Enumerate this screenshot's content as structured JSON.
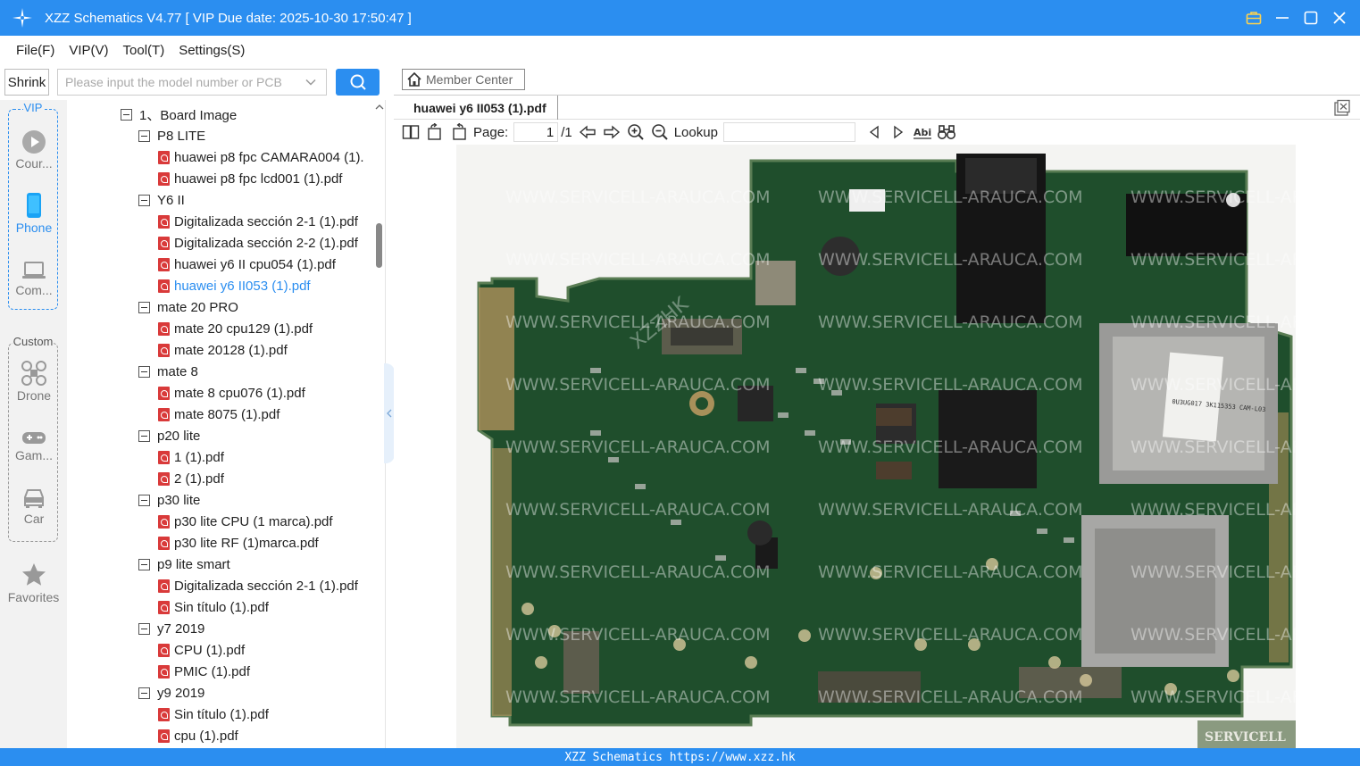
{
  "window": {
    "title": "XZZ Schematics V4.77 [ VIP Due date: 2025-10-30 17:50:47 ]",
    "accent_color": "#2b8ef0",
    "controls": [
      "briefcase-icon",
      "minimize-icon",
      "maximize-icon",
      "close-icon"
    ]
  },
  "menu": {
    "file": "File(F)",
    "vip": "VIP(V)",
    "tool": "Tool(T)",
    "settings": "Settings(S)"
  },
  "left_toolbar": {
    "shrink_label": "Shrink",
    "search_placeholder": "Please input the model number or PCB"
  },
  "categories": {
    "vip_label": "VIP",
    "custom_label": "Custom",
    "items": [
      {
        "label": "Cour...",
        "icon": "play-icon"
      },
      {
        "label": "Phone",
        "icon": "phone-icon"
      },
      {
        "label": "Com...",
        "icon": "laptop-icon"
      },
      {
        "label": "Drone",
        "icon": "drone-icon"
      },
      {
        "label": "Gam...",
        "icon": "gamepad-icon"
      },
      {
        "label": "Car",
        "icon": "car-icon"
      }
    ],
    "favorites_label": "Favorites"
  },
  "tree": {
    "root": "1、Board Image",
    "nodes": [
      {
        "type": "folder",
        "label": "P8 LITE"
      },
      {
        "type": "file",
        "label": "huawei p8 fpc CAMARA004 (1)."
      },
      {
        "type": "file",
        "label": "huawei p8 fpc lcd001 (1).pdf"
      },
      {
        "type": "folder",
        "label": "Y6 II"
      },
      {
        "type": "file",
        "label": "Digitalizada sección 2-1 (1).pdf"
      },
      {
        "type": "file",
        "label": "Digitalizada sección 2-2 (1).pdf"
      },
      {
        "type": "file",
        "label": "huawei y6 II cpu054 (1).pdf"
      },
      {
        "type": "file",
        "label": "huawei y6 II053 (1).pdf",
        "selected": true
      },
      {
        "type": "folder",
        "label": "mate 20 PRO"
      },
      {
        "type": "file",
        "label": "mate 20 cpu129 (1).pdf"
      },
      {
        "type": "file",
        "label": "mate 20128 (1).pdf"
      },
      {
        "type": "folder",
        "label": "mate 8"
      },
      {
        "type": "file",
        "label": "mate 8 cpu076 (1).pdf"
      },
      {
        "type": "file",
        "label": "mate 8075 (1).pdf"
      },
      {
        "type": "folder",
        "label": "p20 lite"
      },
      {
        "type": "file",
        "label": "1 (1).pdf"
      },
      {
        "type": "file",
        "label": "2 (1).pdf"
      },
      {
        "type": "folder",
        "label": "p30 lite"
      },
      {
        "type": "file",
        "label": "p30 lite CPU (1 marca).pdf"
      },
      {
        "type": "file",
        "label": "p30 lite RF (1)marca.pdf"
      },
      {
        "type": "folder",
        "label": "p9 lite smart"
      },
      {
        "type": "file",
        "label": "Digitalizada sección 2-1 (1).pdf"
      },
      {
        "type": "file",
        "label": "Sin título (1).pdf"
      },
      {
        "type": "folder",
        "label": "y7 2019"
      },
      {
        "type": "file",
        "label": "CPU (1).pdf"
      },
      {
        "type": "file",
        "label": "PMIC (1).pdf"
      },
      {
        "type": "folder",
        "label": "y9 2019"
      },
      {
        "type": "file",
        "label": "Sin título (1).pdf"
      },
      {
        "type": "file",
        "label": "cpu (1).pdf"
      }
    ]
  },
  "member_center": "Member Center",
  "document": {
    "tab_title": "huawei y6 II053 (1).pdf",
    "page_label": "Page:",
    "page_current": "1",
    "page_total": "/1",
    "lookup_label": "Lookup",
    "watermark": "WWW.SERVICELL-ARAUCA.COM",
    "watermark2": "XZZHK",
    "chip_text": "0U3UG017 3K115353 CAM-L03",
    "corner_logo": "SERVICELL"
  },
  "status": {
    "text": "XZZ Schematics https://www.xzz.hk"
  }
}
